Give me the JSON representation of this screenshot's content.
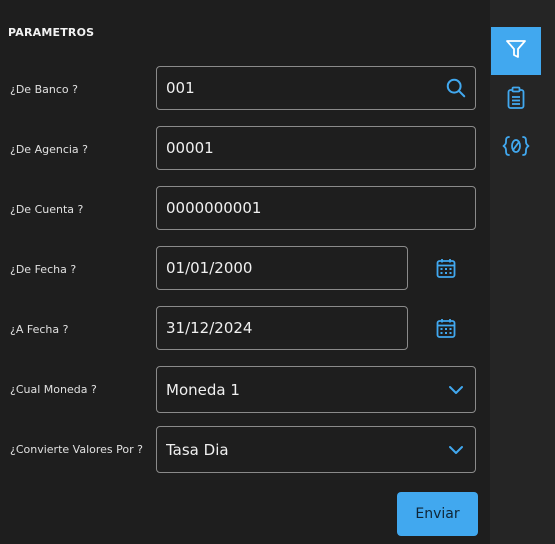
{
  "section": {
    "title": "PARAMETROS"
  },
  "fields": {
    "banco": {
      "label": "¿De Banco ?",
      "value": "001"
    },
    "agencia": {
      "label": "¿De Agencia ?",
      "value": "00001"
    },
    "cuenta": {
      "label": "¿De Cuenta ?",
      "value": "0000000001"
    },
    "de_fecha": {
      "label": "¿De Fecha ?",
      "value": "01/01/2000"
    },
    "a_fecha": {
      "label": "¿A Fecha ?",
      "value": "31/12/2024"
    },
    "moneda": {
      "label": "¿Cual Moneda ?",
      "value": "Moneda 1"
    },
    "convierte": {
      "label": "¿Convierte Valores Por ?",
      "value": "Tasa Dia"
    }
  },
  "actions": {
    "submit_label": "Enviar"
  },
  "rail": {
    "items": [
      {
        "icon": "filter-icon",
        "active": true
      },
      {
        "icon": "clipboard-icon",
        "active": false
      },
      {
        "icon": "variables-icon",
        "active": false
      }
    ]
  },
  "colors": {
    "accent": "#41a8ef",
    "background": "#1e1e1e",
    "rail_background": "#252525",
    "border": "#8a8a8a"
  }
}
